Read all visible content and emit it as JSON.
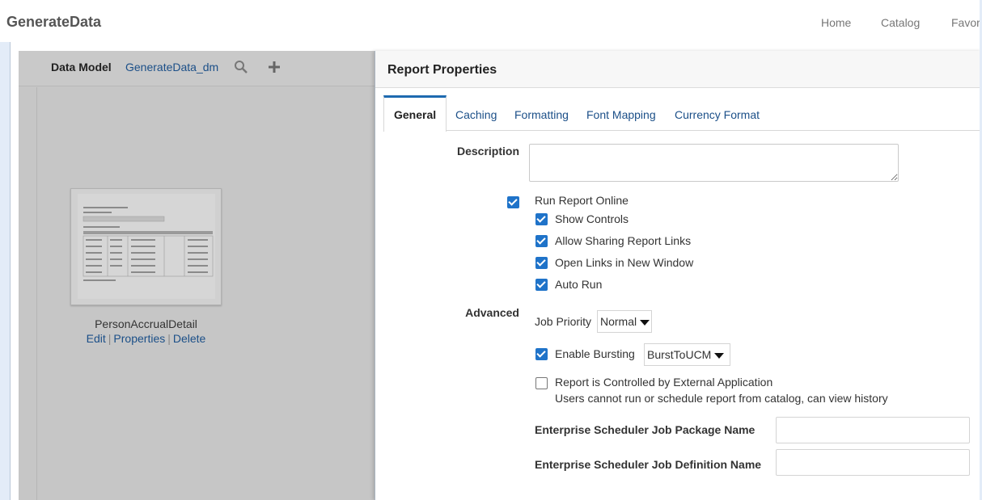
{
  "app": {
    "title": "GenerateData"
  },
  "topnav": [
    "Home",
    "Catalog",
    "Favor"
  ],
  "data_model": {
    "label": "Data Model",
    "link": "GenerateData_dm",
    "search_icon": "search-icon",
    "add_icon": "plus-icon"
  },
  "layout_item": {
    "name": "PersonAccrualDetail",
    "actions": [
      "Edit",
      "Properties",
      "Delete"
    ]
  },
  "dialog": {
    "title": "Report Properties",
    "tabs": [
      "General",
      "Caching",
      "Formatting",
      "Font Mapping",
      "Currency Format"
    ],
    "active_tab": "General",
    "description_label": "Description",
    "description_value": "",
    "run_online": {
      "label": "Run Report Online",
      "checked": true
    },
    "options": [
      {
        "label": "Show Controls",
        "checked": true
      },
      {
        "label": "Allow Sharing Report Links",
        "checked": true
      },
      {
        "label": "Open Links in New Window",
        "checked": true
      },
      {
        "label": "Auto Run",
        "checked": true
      }
    ],
    "advanced_label": "Advanced",
    "job_priority": {
      "label": "Job Priority",
      "value": "Normal"
    },
    "bursting": {
      "label": "Enable Bursting",
      "checked": true,
      "value": "BurstToUCM"
    },
    "external": {
      "label": "Report is Controlled by External Application",
      "note": "Users cannot run or schedule report from catalog, can view history",
      "checked": false
    },
    "ess_package": {
      "label": "Enterprise Scheduler Job Package Name",
      "value": ""
    },
    "ess_definition": {
      "label": "Enterprise Scheduler Job Definition Name",
      "value": ""
    }
  },
  "colors": {
    "accent": "#1f73c9",
    "link": "#1b4f88",
    "overlay": "#c6c6c6"
  }
}
